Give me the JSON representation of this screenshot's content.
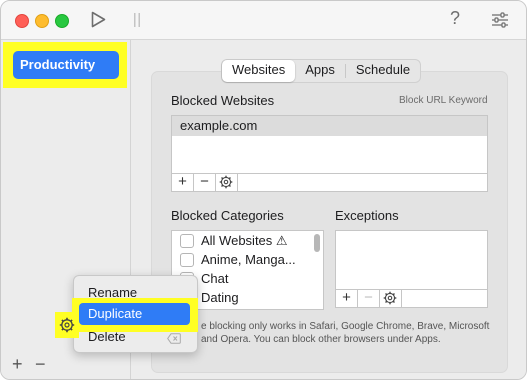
{
  "toolbar": {
    "play_icon": "play-icon",
    "pause_icon": "pause-icon",
    "help_label": "?",
    "settings_icon": "sliders-icon"
  },
  "sidebar": {
    "items": [
      {
        "label": "Productivity",
        "selected": true
      }
    ],
    "add_label": "+",
    "remove_label": "−",
    "gear_icon": "gear-icon"
  },
  "tabs": [
    {
      "label": "Websites",
      "active": true
    },
    {
      "label": "Apps",
      "active": false
    },
    {
      "label": "Schedule",
      "active": false
    }
  ],
  "blocked_websites": {
    "title": "Blocked Websites",
    "keyword_link": "Block URL Keyword",
    "items": [
      "example.com"
    ]
  },
  "blocked_categories": {
    "title": "Blocked Categories",
    "items": [
      {
        "label": "All Websites ⚠",
        "checked": false
      },
      {
        "label": "Anime, Manga...",
        "checked": false
      },
      {
        "label": "Chat",
        "checked": false
      },
      {
        "label": "Dating",
        "checked": false
      }
    ]
  },
  "exceptions": {
    "title": "Exceptions"
  },
  "list_tools": {
    "add": "+",
    "remove": "−"
  },
  "footnote": "e blocking only works in Safari, Google Chrome, Brave, Microsoft and Opera. You can block other browsers under Apps.",
  "context_menu": {
    "items": [
      "Rename",
      "Duplicate",
      "Delete"
    ],
    "selected": "Duplicate"
  },
  "colors": {
    "accent": "#2f7cf6",
    "highlight": "#ffff24"
  }
}
